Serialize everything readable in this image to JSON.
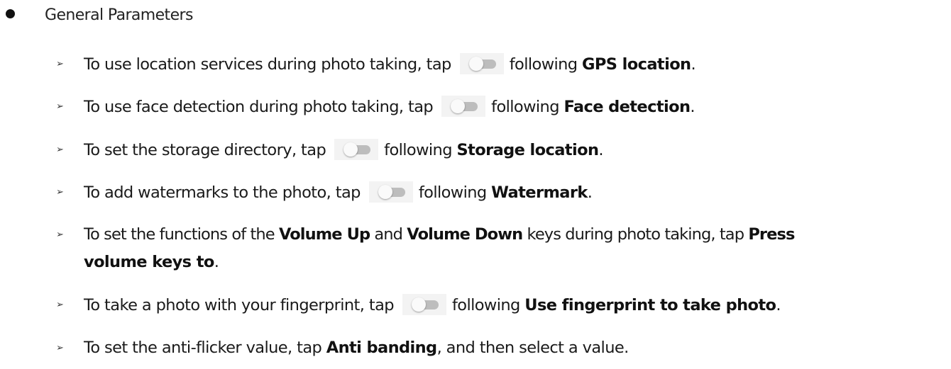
{
  "section": {
    "title": "General Parameters"
  },
  "items": [
    {
      "before": "To use location services during photo taking, tap",
      "after": "following ",
      "bold": "GPS location",
      "end": "."
    },
    {
      "before": "To use face detection during photo taking, tap",
      "after": "following ",
      "bold": "Face detection",
      "end": "."
    },
    {
      "before": "To set the storage directory, tap",
      "after": "following ",
      "bold": "Storage location",
      "end": "."
    },
    {
      "before": "To add watermarks to the photo, tap",
      "after": "following ",
      "bold": "Watermark",
      "end": "."
    },
    {
      "part1": "To set the functions of the ",
      "bold1": "Volume Up",
      "part2": " and ",
      "bold2": "Volume Down",
      "part3": " keys during photo taking, tap ",
      "bold3": "Press",
      "bold3_cont": "volume keys to",
      "end": "."
    },
    {
      "before": "To take a photo with your fingerprint, tap",
      "after": "following ",
      "bold": "Use fingerprint to take photo",
      "end": "."
    },
    {
      "part1": "To set the anti-flicker value, tap ",
      "bold1": "Anti banding",
      "part2": ", and then select a value."
    }
  ],
  "icons": {
    "bullet": "filled-circle-bullet",
    "sub_bullet": "arrowhead-bullet",
    "toggle": "toggle-switch-off-icon"
  },
  "colors": {
    "text": "#1a1a1a",
    "toggle_track": "#bdbdbd",
    "toggle_knob": "#fafafa"
  }
}
